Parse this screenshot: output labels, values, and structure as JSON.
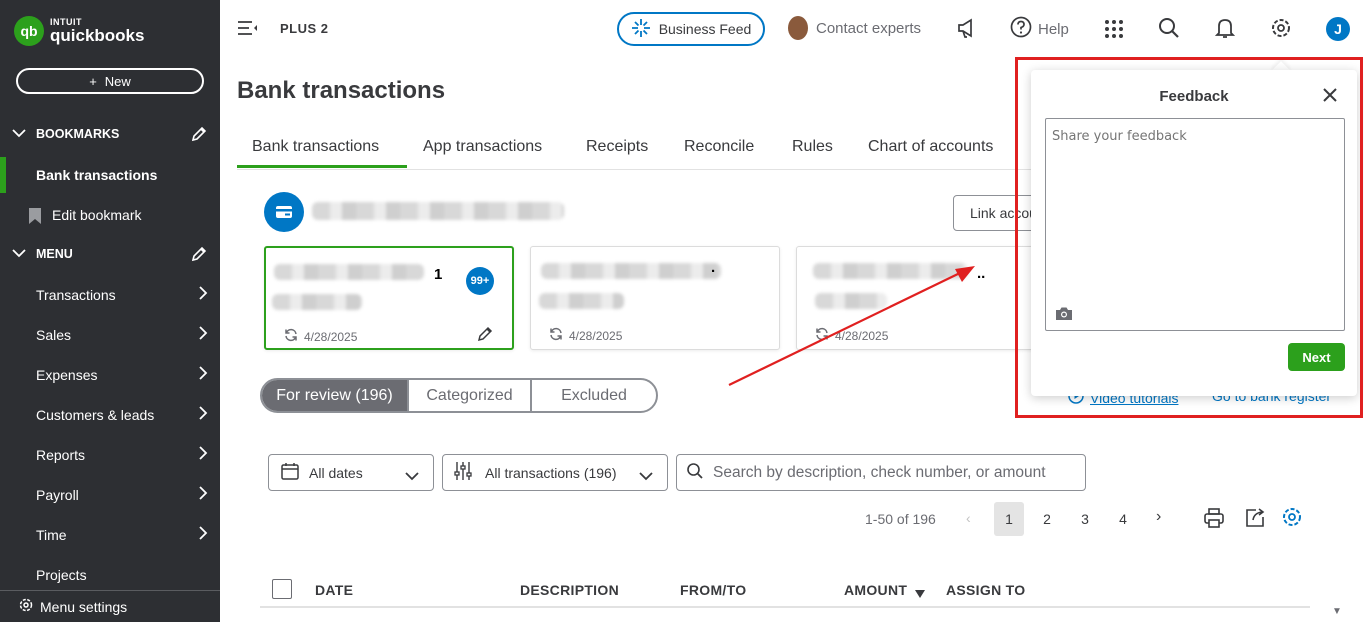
{
  "sidebar": {
    "logo_intuit": "INTUIT",
    "logo_name": "quickbooks",
    "logo_mark": "qb",
    "new_label": "New",
    "bookmarks_header": "BOOKMARKS",
    "menu_header": "MENU",
    "bookmark_items": [
      {
        "label": "Bank transactions",
        "active": true
      },
      {
        "label": "Edit bookmark"
      }
    ],
    "menu_items": [
      {
        "label": "Transactions",
        "arrow": true
      },
      {
        "label": "Sales",
        "arrow": true
      },
      {
        "label": "Expenses",
        "arrow": true
      },
      {
        "label": "Customers & leads",
        "arrow": true
      },
      {
        "label": "Reports",
        "arrow": true
      },
      {
        "label": "Payroll",
        "arrow": true
      },
      {
        "label": "Time",
        "arrow": true
      },
      {
        "label": "Projects",
        "arrow": false
      }
    ],
    "menu_settings": "Menu settings"
  },
  "topbar": {
    "plan": "PLUS 2",
    "business_feed": "Business Feed",
    "contact_experts": "Contact experts",
    "help": "Help",
    "user_initial": "J"
  },
  "page": {
    "title": "Bank transactions",
    "tabs": [
      "Bank transactions",
      "App transactions",
      "Receipts",
      "Reconcile",
      "Rules",
      "Chart of accounts"
    ],
    "link_account": "Link account"
  },
  "cards": [
    {
      "date": "4/28/2025",
      "badge": "99+",
      "suffix": "1"
    },
    {
      "date": "4/28/2025",
      "suffix": "."
    },
    {
      "date": "4/28/2025",
      "suffix": ".."
    }
  ],
  "review_tabs": [
    "For review (196)",
    "Categorized",
    "Excluded"
  ],
  "links": {
    "video_tutorials": "Video tutorials",
    "bank_register": "Go to bank register"
  },
  "filters": {
    "dates": "All dates",
    "transactions": "All transactions (196)",
    "search_placeholder": "Search by description, check number, or amount"
  },
  "pagination": {
    "range": "1-50 of 196",
    "pages": [
      "1",
      "2",
      "3",
      "4"
    ],
    "current": "1"
  },
  "table": {
    "columns": [
      "DATE",
      "DESCRIPTION",
      "FROM/TO",
      "AMOUNT",
      "ASSIGN TO"
    ]
  },
  "feedback": {
    "title": "Feedback",
    "placeholder": "Share your feedback",
    "next": "Next"
  },
  "colors": {
    "brand_green": "#2ca01c",
    "accent_blue": "#0077c5",
    "annotation_red": "#e02020",
    "sidebar_bg": "#2d2f33"
  }
}
